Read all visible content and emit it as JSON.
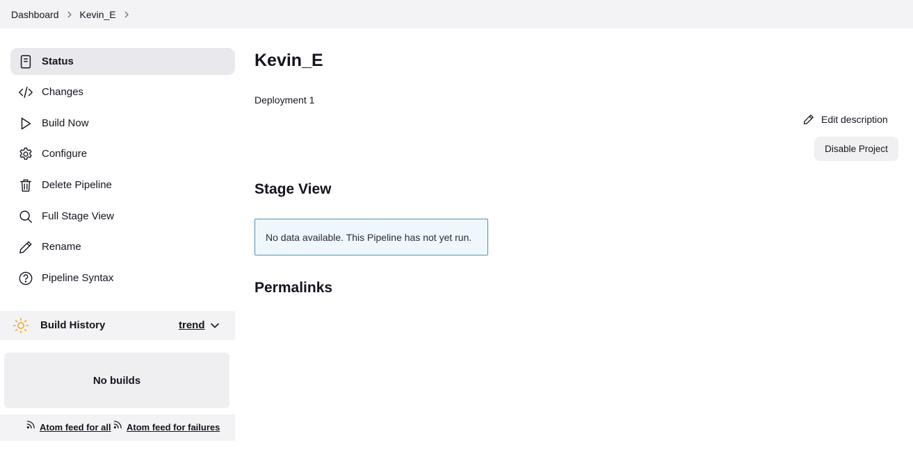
{
  "breadcrumb": [
    {
      "label": "Dashboard"
    },
    {
      "label": "Kevin_E"
    }
  ],
  "sidebar": {
    "items": [
      {
        "label": "Status",
        "icon": "document-icon",
        "active": true
      },
      {
        "label": "Changes",
        "icon": "code-icon",
        "active": false
      },
      {
        "label": "Build Now",
        "icon": "play-icon",
        "active": false
      },
      {
        "label": "Configure",
        "icon": "gear-icon",
        "active": false
      },
      {
        "label": "Delete Pipeline",
        "icon": "trash-icon",
        "active": false
      },
      {
        "label": "Full Stage View",
        "icon": "search-icon",
        "active": false
      },
      {
        "label": "Rename",
        "icon": "pencil-icon",
        "active": false
      },
      {
        "label": "Pipeline Syntax",
        "icon": "help-icon",
        "active": false
      }
    ]
  },
  "build_history": {
    "title": "Build History",
    "trend_label": "trend",
    "empty_text": "No builds",
    "feed_all": "Atom feed for all",
    "feed_failures": "Atom feed for failures",
    "sun_color": "#f5a623"
  },
  "main": {
    "title": "Kevin_E",
    "description": "Deployment 1",
    "edit_description": "Edit description",
    "disable_button": "Disable Project",
    "stage_view_heading": "Stage View",
    "stage_view_notice": "No data available. This Pipeline has not yet run.",
    "permalinks_heading": "Permalinks"
  },
  "colors": {
    "notice_border": "#4c8fba",
    "notice_background": "#eef8fc"
  }
}
